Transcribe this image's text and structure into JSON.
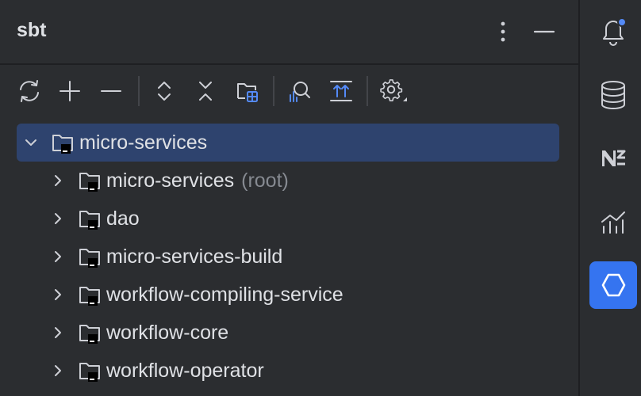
{
  "panel": {
    "title": "sbt"
  },
  "toolbar": {
    "buttons": [
      "reload-icon",
      "plus-icon",
      "minus-icon",
      "expand-all-icon",
      "collapse-all-icon",
      "module-folder-icon",
      "analyze-icon",
      "sort-icon",
      "settings-icon"
    ]
  },
  "tree": {
    "root": {
      "label": "micro-services",
      "expanded": true
    },
    "children": [
      {
        "label": "micro-services",
        "suffix": "(root)"
      },
      {
        "label": "dao",
        "suffix": ""
      },
      {
        "label": "micro-services-build",
        "suffix": ""
      },
      {
        "label": "workflow-compiling-service",
        "suffix": ""
      },
      {
        "label": "workflow-core",
        "suffix": ""
      },
      {
        "label": "workflow-operator",
        "suffix": ""
      }
    ]
  },
  "rightbar": {
    "items": [
      "notifications-icon",
      "database-icon",
      "n2-icon",
      "profiler-icon",
      "sbt-icon"
    ],
    "active": "sbt-icon",
    "notification_badge_color": "#548af7"
  },
  "colors": {
    "background": "#2b2d30",
    "selection": "#2e436e",
    "accent": "#3574f0",
    "text": "#dfe1e5",
    "muted": "#868a91"
  }
}
